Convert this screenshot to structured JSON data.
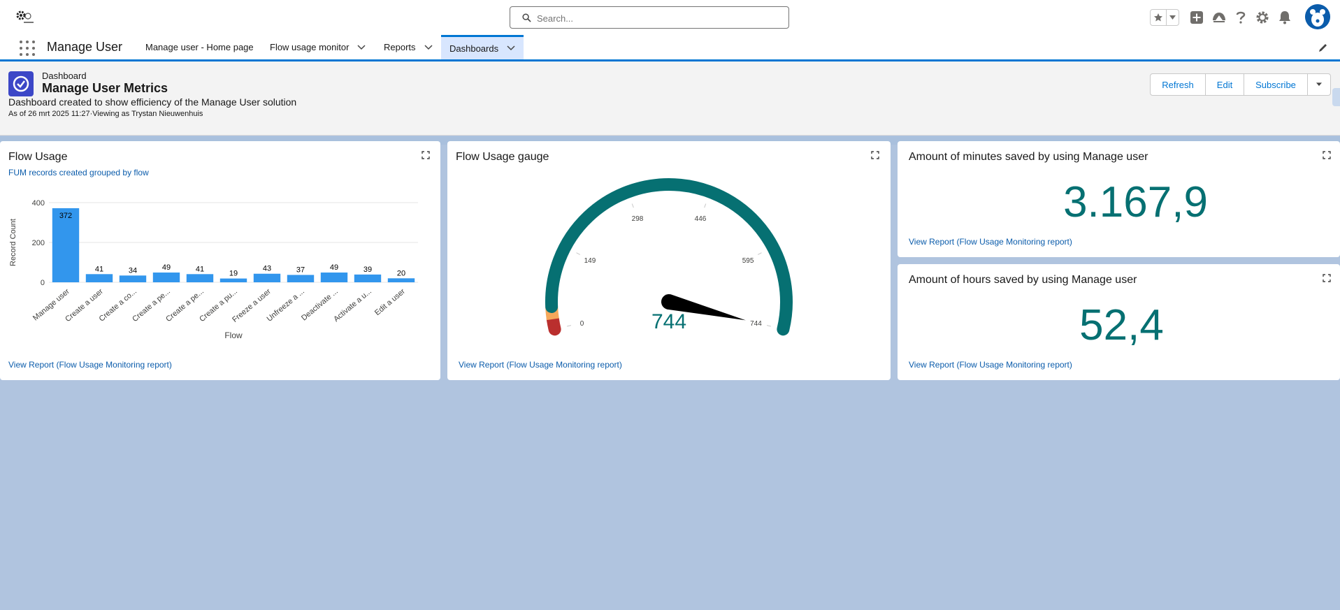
{
  "header": {
    "search_placeholder": "Search...",
    "icons": [
      "gear-logo-icon",
      "star-icon",
      "chevron-down-icon",
      "plus-icon",
      "trailhead-icon",
      "help-icon",
      "setup-gear-icon",
      "bell-icon",
      "avatar"
    ]
  },
  "nav": {
    "app_name": "Manage User",
    "tabs": [
      {
        "label": "Manage user - Home page",
        "has_menu": false
      },
      {
        "label": "Flow usage monitor",
        "has_menu": true
      },
      {
        "label": "Reports",
        "has_menu": true
      },
      {
        "label": "Dashboards",
        "has_menu": true,
        "active": true
      }
    ]
  },
  "dashboard": {
    "eyebrow": "Dashboard",
    "title": "Manage User Metrics",
    "description": "Dashboard created to show efficiency of the Manage User solution",
    "meta": "As of 26 mrt 2025 11:27·Viewing as Trystan Nieuwenhuis",
    "buttons": {
      "refresh": "Refresh",
      "edit": "Edit",
      "subscribe": "Subscribe"
    }
  },
  "widgets": {
    "flow_usage": {
      "title": "Flow Usage",
      "subtitle": "FUM records created grouped by flow",
      "link": "View Report (Flow Usage Monitoring report)"
    },
    "gauge": {
      "title": "Flow Usage gauge",
      "value_label": "744",
      "link": "View Report (Flow Usage Monitoring report)"
    },
    "minutes": {
      "title": "Amount of minutes saved by using Manage user",
      "value": "3.167,9",
      "link": "View Report (Flow Usage Monitoring report)"
    },
    "hours": {
      "title": "Amount of hours saved by using Manage user",
      "value": "52,4",
      "link": "View Report (Flow Usage Monitoring report)"
    }
  },
  "colors": {
    "brand": "#0176d3",
    "bar": "#3296ed",
    "gauge_green": "#067072",
    "gauge_red": "#ba2f2e",
    "gauge_orange": "#f5a85b",
    "canvas": "#b0c4df"
  },
  "chart_data": [
    {
      "type": "bar",
      "xlabel": "Flow",
      "ylabel": "Record Count",
      "yticks": [
        0,
        200,
        400
      ],
      "ylim": [
        0,
        400
      ],
      "grid": true,
      "categories": [
        "Manage user",
        "Create a user",
        "Create a co...",
        "Create a pe...",
        "Create a pe...",
        "Create a pu...",
        "Freeze a user",
        "Unfreeze a ...",
        "Deactivate ...",
        "Activate a u...",
        "Edit a user"
      ],
      "values": [
        372,
        41,
        34,
        49,
        41,
        19,
        43,
        37,
        49,
        39,
        20
      ],
      "data_labels": true
    },
    {
      "type": "gauge",
      "min": 0,
      "max": 744,
      "value": 744,
      "ticks": [
        0,
        149,
        298,
        446,
        595,
        744
      ],
      "bands": [
        {
          "from": 0,
          "to": 18,
          "color": "#ba2f2e"
        },
        {
          "from": 18,
          "to": 40,
          "color": "#f5a85b"
        },
        {
          "from": 40,
          "to": 744,
          "color": "#067072"
        }
      ]
    }
  ]
}
